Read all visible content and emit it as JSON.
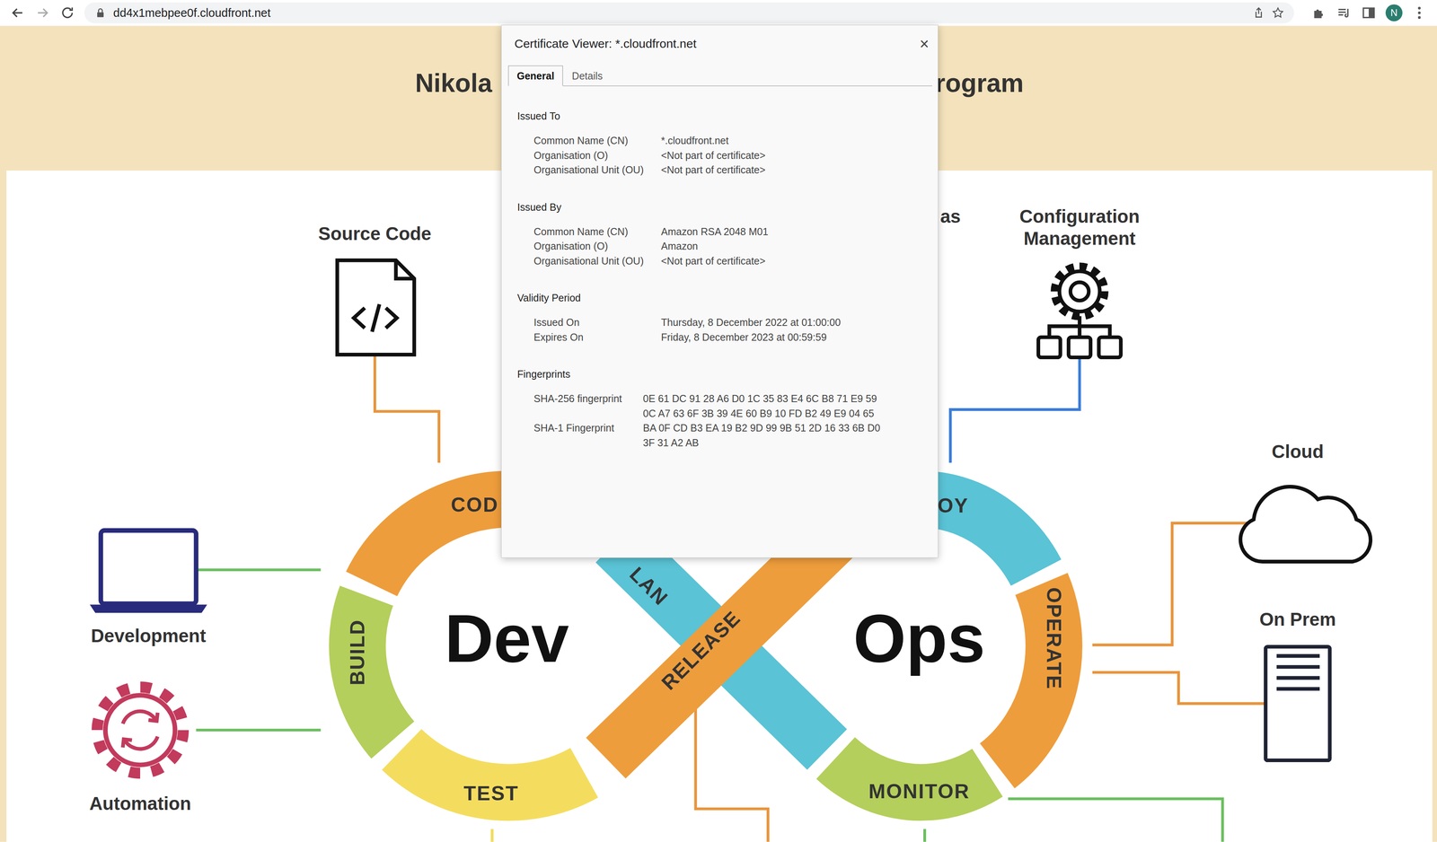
{
  "browser": {
    "url": "dd4x1mebpee0f.cloudfront.net",
    "profile_initial": "N"
  },
  "page": {
    "title_left": "Nikola",
    "title_right": "rogram",
    "partial_label": "as",
    "nodes": [
      {
        "kind": "file",
        "lines": [
          "Source Code"
        ]
      },
      {
        "kind": "config",
        "lines": [
          "Configuration",
          "Management"
        ]
      },
      {
        "kind": "cloud",
        "lines": [
          "Cloud"
        ]
      },
      {
        "kind": "server",
        "lines": [
          "On Prem"
        ]
      },
      {
        "kind": "laptop",
        "lines": [
          "Development"
        ]
      },
      {
        "kind": "automation",
        "lines": [
          "Automation"
        ]
      }
    ],
    "loop": {
      "left": "Dev",
      "right": "Ops",
      "stages": [
        {
          "label": "COD",
          "color": "#ee9d3c"
        },
        {
          "label": "BUILD",
          "color": "#b4cf5b"
        },
        {
          "label": "TEST",
          "color": "#f4dd5e"
        },
        {
          "label": "LAN",
          "color": "#5ac3d5"
        },
        {
          "label": "RELEASE",
          "color": "#ee9d3c"
        },
        {
          "label": "OY",
          "color": "#5ac3d5"
        },
        {
          "label": "OPERATE",
          "color": "#ee9d3c"
        },
        {
          "label": "MONITOR",
          "color": "#b4cf5b"
        }
      ]
    }
  },
  "dialog": {
    "title": "Certificate Viewer: *.cloudfront.net",
    "close": "×",
    "tabs": [
      {
        "label": "General",
        "selected": true
      },
      {
        "label": "Details",
        "selected": false
      }
    ],
    "sections": [
      {
        "heading": "Issued To",
        "kind": "fields",
        "rows": [
          {
            "label": "Common Name (CN)",
            "value": [
              "*.cloudfront.net"
            ]
          },
          {
            "label": "Organisation (O)",
            "value": [
              "<Not part of certificate>"
            ]
          },
          {
            "label": "Organisational Unit (OU)",
            "value": [
              "<Not part of certificate>"
            ]
          }
        ]
      },
      {
        "heading": "Issued By",
        "kind": "fields",
        "rows": [
          {
            "label": "Common Name (CN)",
            "value": [
              "Amazon RSA 2048 M01"
            ]
          },
          {
            "label": "Organisation (O)",
            "value": [
              "Amazon"
            ]
          },
          {
            "label": "Organisational Unit (OU)",
            "value": [
              "<Not part of certificate>"
            ]
          }
        ]
      },
      {
        "heading": "Validity Period",
        "kind": "fields",
        "rows": [
          {
            "label": "Issued On",
            "value": [
              "Thursday, 8 December 2022 at 01:00:00"
            ]
          },
          {
            "label": "Expires On",
            "value": [
              "Friday, 8 December 2023 at 00:59:59"
            ]
          }
        ]
      },
      {
        "heading": "Fingerprints",
        "kind": "fingerprints",
        "rows": [
          {
            "label": "SHA-256 fingerprint",
            "value": [
              "0E 61 DC 91 28 A6 D0 1C 35 83 E4 6C B8 71 E9 59",
              "0C A7 63 6F 3B 39 4E 60 B9 10 FD B2 49 E9 04 65"
            ]
          },
          {
            "label": "SHA-1 Fingerprint",
            "value": [
              "BA 0F CD B3 EA 19 B2 9D 99 9B 51 2D 16 33 6B D0",
              "3F 31 A2 AB"
            ]
          }
        ]
      }
    ]
  }
}
